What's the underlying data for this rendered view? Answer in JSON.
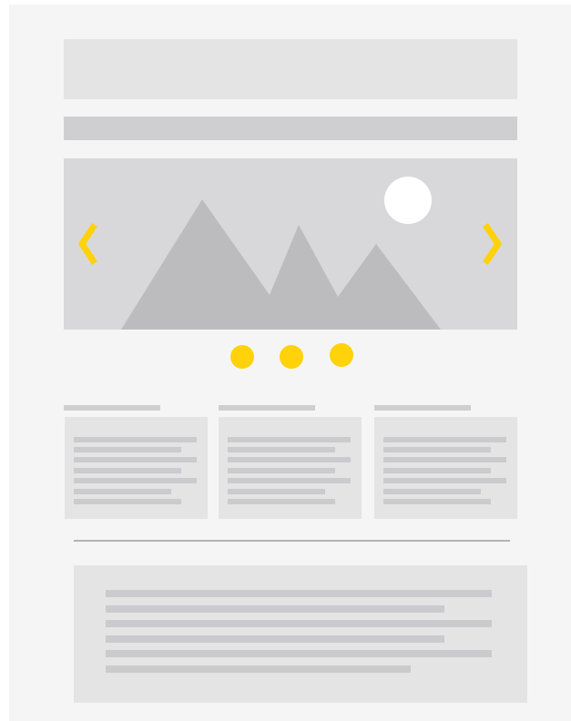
{
  "page": {
    "header_placeholder": "",
    "nav_placeholder": ""
  },
  "carousel": {
    "prev_icon": "chevron-left-icon",
    "next_icon": "chevron-right-icon",
    "image_icon": "landscape-image-icon",
    "slide_count": 3,
    "accent_color": "#ffd20a"
  },
  "cards": [
    {
      "heading": "",
      "text_lines": 7
    },
    {
      "heading": "",
      "text_lines": 7
    },
    {
      "heading": "",
      "text_lines": 7
    }
  ],
  "footer": {
    "text_lines": 6
  },
  "colors": {
    "background": "#f5f5f5",
    "block": "#e4e4e5",
    "placeholder_line": "#cbcbcd",
    "mountain": "#bcbcbe",
    "sun": "#ffffff",
    "accent": "#ffd20a"
  }
}
